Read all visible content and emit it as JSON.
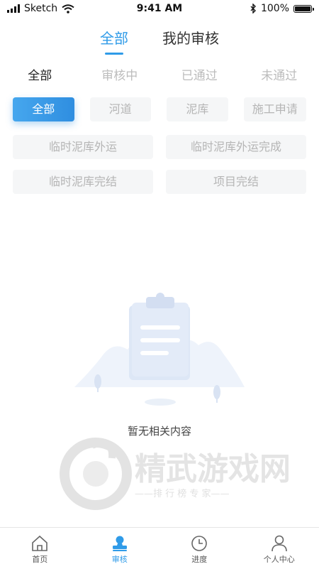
{
  "status_bar": {
    "carrier": "Sketch",
    "time": "9:41 AM",
    "battery": "100%",
    "battery_level": 1.0
  },
  "top_tabs": [
    {
      "label": "全部",
      "active": true
    },
    {
      "label": "我的审核",
      "active": false
    }
  ],
  "sub_tabs": [
    {
      "label": "全部",
      "active": true
    },
    {
      "label": "审核中",
      "active": false
    },
    {
      "label": "已通过",
      "active": false
    },
    {
      "label": "未通过",
      "active": false
    }
  ],
  "filters": {
    "row1": [
      "全部",
      "河道",
      "泥库",
      "施工申请"
    ],
    "row2": [
      "临时泥库外运",
      "临时泥库外运完成"
    ],
    "row3": [
      "临时泥库完结",
      "项目完结"
    ],
    "active": "全部"
  },
  "empty_state": {
    "message": "暂无相关内容",
    "icon": "clipboard-icon"
  },
  "watermark": {
    "title": "精武游戏网",
    "subtitle": "——排 行 榜 专 家——"
  },
  "bottom_nav": [
    {
      "label": "首页",
      "icon": "home-icon",
      "active": false
    },
    {
      "label": "审核",
      "icon": "review-stamp-icon",
      "active": true
    },
    {
      "label": "进度",
      "icon": "clock-icon",
      "active": false
    },
    {
      "label": "个人中心",
      "icon": "user-icon",
      "active": false
    }
  ],
  "colors": {
    "accent": "#2f9be8",
    "chip_bg": "#f5f6f7",
    "chip_text": "#b5b5b5"
  }
}
